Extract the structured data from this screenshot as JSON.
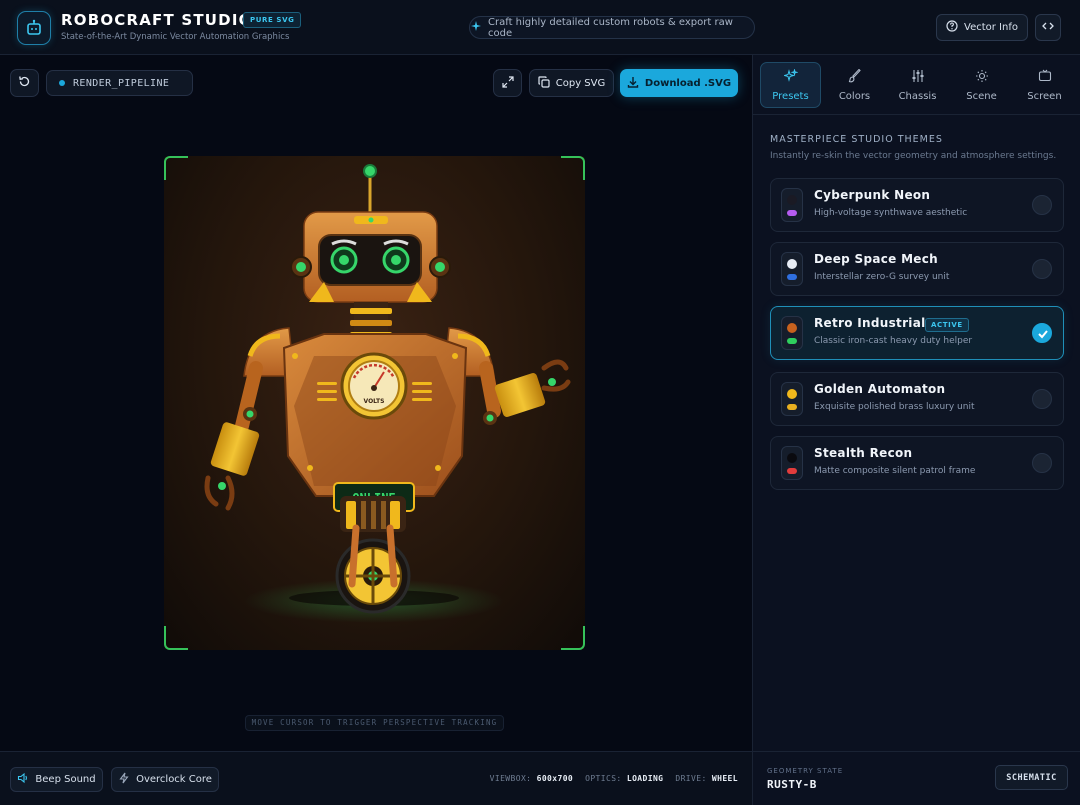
{
  "header": {
    "brand_title": "ROBOCRAFT STUDIO",
    "brand_badge": "PURE SVG",
    "brand_subtitle": "State-of-the-Art Dynamic Vector Automation Graphics",
    "tagline": "Craft highly detailed custom robots & export raw code",
    "vector_info_label": "Vector Info"
  },
  "toolbar": {
    "pipeline_label": "RENDER_PIPELINE",
    "copy_svg_label": "Copy SVG",
    "download_label": "Download .SVG"
  },
  "canvas": {
    "hint": "MOVE CURSOR TO TRIGGER PERSPECTIVE TRACKING",
    "robot_screen_text": "ONLINE",
    "gauge_label": "VOLTS"
  },
  "footer": {
    "beep_label": "Beep Sound",
    "overclock_label": "Overclock Core",
    "viewbox_key": "VIEWBOX:",
    "viewbox_value": "600x700",
    "optics_key": "OPTICS:",
    "optics_value": "LOADING",
    "drive_key": "DRIVE:",
    "drive_value": "WHEEL"
  },
  "sidebar": {
    "tabs": [
      {
        "label": "Presets",
        "icon": "sparkles-icon",
        "active": true
      },
      {
        "label": "Colors",
        "icon": "brush-icon"
      },
      {
        "label": "Chassis",
        "icon": "sliders-icon"
      },
      {
        "label": "Scene",
        "icon": "sun-icon"
      },
      {
        "label": "Screen",
        "icon": "monitor-icon"
      }
    ],
    "section_title": "MASTERPIECE STUDIO THEMES",
    "section_subtitle": "Instantly re-skin the vector geometry and atmosphere settings.",
    "active_badge": "ACTIVE",
    "themes": [
      {
        "title": "Cyberpunk Neon",
        "subtitle": "High-voltage synthwave aesthetic",
        "dot_color": "#1a1a24",
        "bar_color": "#b65cf0"
      },
      {
        "title": "Deep Space Mech",
        "subtitle": "Interstellar zero-G survey unit",
        "dot_color": "#e8edf5",
        "bar_color": "#2f6fe0"
      },
      {
        "title": "Retro Industrial",
        "subtitle": "Classic iron-cast heavy duty helper",
        "dot_color": "#c8621e",
        "bar_color": "#2fce5e"
      },
      {
        "title": "Golden Automaton",
        "subtitle": "Exquisite polished brass luxury unit",
        "dot_color": "#f0b81c",
        "bar_color": "#e8b020"
      },
      {
        "title": "Stealth Recon",
        "subtitle": "Matte composite silent patrol frame",
        "dot_color": "#0a0a0f",
        "bar_color": "#e23c3c"
      }
    ],
    "geometry_state_label": "GEOMETRY STATE",
    "geometry_state_value": "RUSTY-B",
    "schematic_label": "SCHEMATIC"
  },
  "colors": {
    "accent": "#1ba8dc",
    "frame_corner": "#36c25a",
    "robot_body": "#c8702c",
    "robot_trim": "#f0b81c",
    "robot_eye": "#36d66a"
  }
}
